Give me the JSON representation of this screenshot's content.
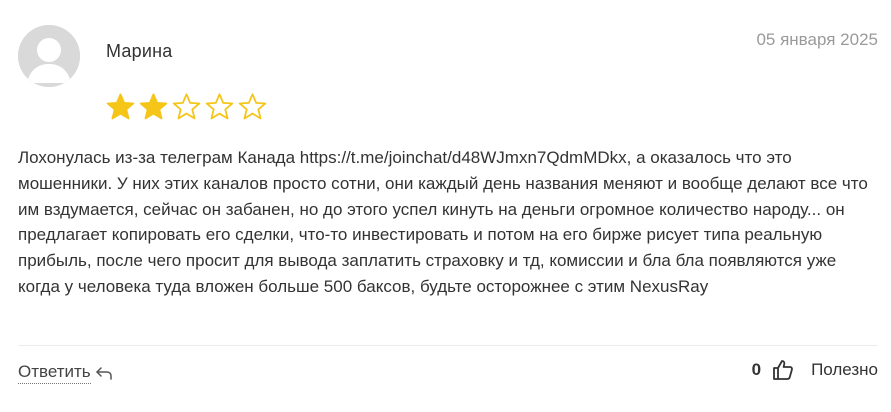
{
  "review": {
    "author": "Марина",
    "date": "05 января 2025",
    "rating": 2,
    "rating_max": 5,
    "star_color": "#f5c518",
    "text": "Лохонулась из-за телеграм Канада https://t.me/joinchat/d48WJmxn7QdmMDkx, а оказалось что это мошенники. У них этих каналов просто сотни, они каждый день названия меняют и вообще делают все что им вздумается, сейчас он забанен, но до этого успел кинуть на деньги огромное количество народу... он предлагает копировать его сделки, что-то инвестировать и потом на его бирже рисует типа реальную прибыль, после чего просит для вывода заплатить страховку и тд, комиссии и бла бла появляются уже когда у человека туда вложен больше 500 баксов, будьте осторожнее с этим NexusRay"
  },
  "actions": {
    "reply_label": "Ответить",
    "reply_icon": "reply-arrow-icon",
    "helpful_count": "0",
    "helpful_icon": "thumbs-up-icon",
    "helpful_label": "Полезно"
  }
}
